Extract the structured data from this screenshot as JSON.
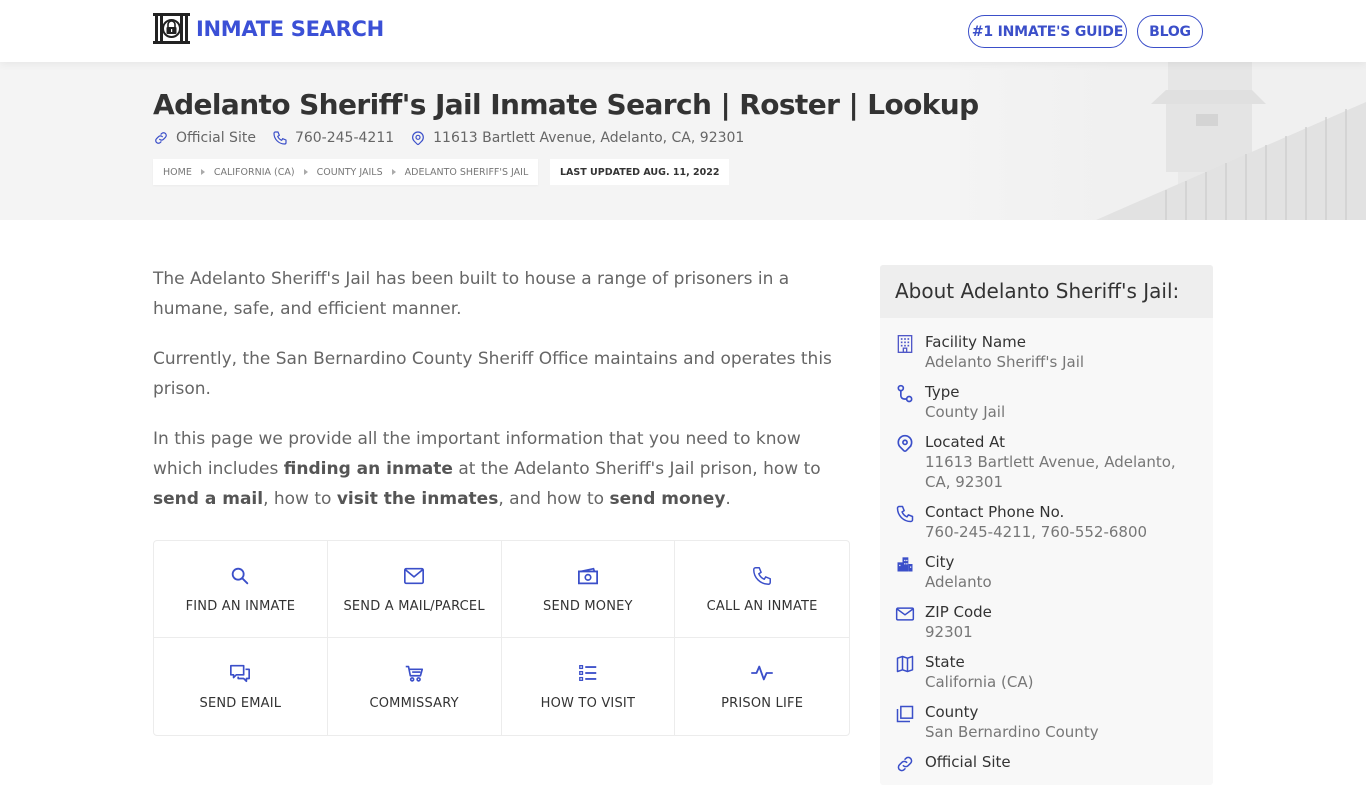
{
  "brand": {
    "name": "INMATE SEARCH",
    "accent": "#3b50d6"
  },
  "nav": {
    "guide_label": "#1 INMATE'S GUIDE",
    "blog_label": "BLOG"
  },
  "hero": {
    "title": "Adelanto Sheriff's Jail Inmate Search | Roster | Lookup",
    "official_site": "Official Site",
    "phone": "760-245-4211",
    "address": "11613 Bartlett Avenue, Adelanto, CA, 92301",
    "breadcrumbs": [
      "HOME",
      "CALIFORNIA (CA)",
      "COUNTY JAILS",
      "ADELANTO SHERIFF'S JAIL"
    ],
    "last_updated": "LAST UPDATED AUG. 11, 2022"
  },
  "content": {
    "p1": "The Adelanto Sheriff's Jail has been built to house a range of prisoners in a humane, safe, and efficient manner.",
    "p2": "Currently, the San Bernardino County Sheriff Office maintains and operates this prison.",
    "p3": {
      "t1": "In this page we provide all the important information that you need to know which includes ",
      "b1": "finding an inmate",
      "t2": " at the Adelanto Sheriff's Jail prison, how to ",
      "b2": "send a mail",
      "t3": ", how to ",
      "b3": "visit the inmates",
      "t4": ", and how to ",
      "b4": "send money",
      "t5": "."
    }
  },
  "tiles": [
    {
      "label": "FIND AN INMATE",
      "icon": "search-icon"
    },
    {
      "label": "SEND A MAIL/PARCEL",
      "icon": "envelope-icon"
    },
    {
      "label": "SEND MONEY",
      "icon": "money-icon"
    },
    {
      "label": "CALL AN INMATE",
      "icon": "phone-icon"
    },
    {
      "label": "SEND EMAIL",
      "icon": "chat-icon"
    },
    {
      "label": "COMMISSARY",
      "icon": "cart-icon"
    },
    {
      "label": "HOW TO VISIT",
      "icon": "list-icon"
    },
    {
      "label": "PRISON LIFE",
      "icon": "activity-icon"
    }
  ],
  "about": {
    "title": "About Adelanto Sheriff's Jail:",
    "items": [
      {
        "label": "Facility Name",
        "value": "Adelanto Sheriff's Jail",
        "icon": "building-icon"
      },
      {
        "label": "Type",
        "value": "County Jail",
        "icon": "route-icon"
      },
      {
        "label": "Located At",
        "value": "11613 Bartlett Avenue, Adelanto, CA, 92301",
        "icon": "map-pin-icon"
      },
      {
        "label": "Contact Phone No.",
        "value": "760-245-4211, 760-552-6800",
        "icon": "phone-icon"
      },
      {
        "label": "City",
        "value": "Adelanto",
        "icon": "city-icon"
      },
      {
        "label": "ZIP Code",
        "value": "92301",
        "icon": "envelope-icon"
      },
      {
        "label": "State",
        "value": "California (CA)",
        "icon": "map-icon"
      },
      {
        "label": "County",
        "value": "San Bernardino County",
        "icon": "copy-icon"
      },
      {
        "label": "Official Site",
        "value": "",
        "icon": "link-icon"
      }
    ]
  }
}
